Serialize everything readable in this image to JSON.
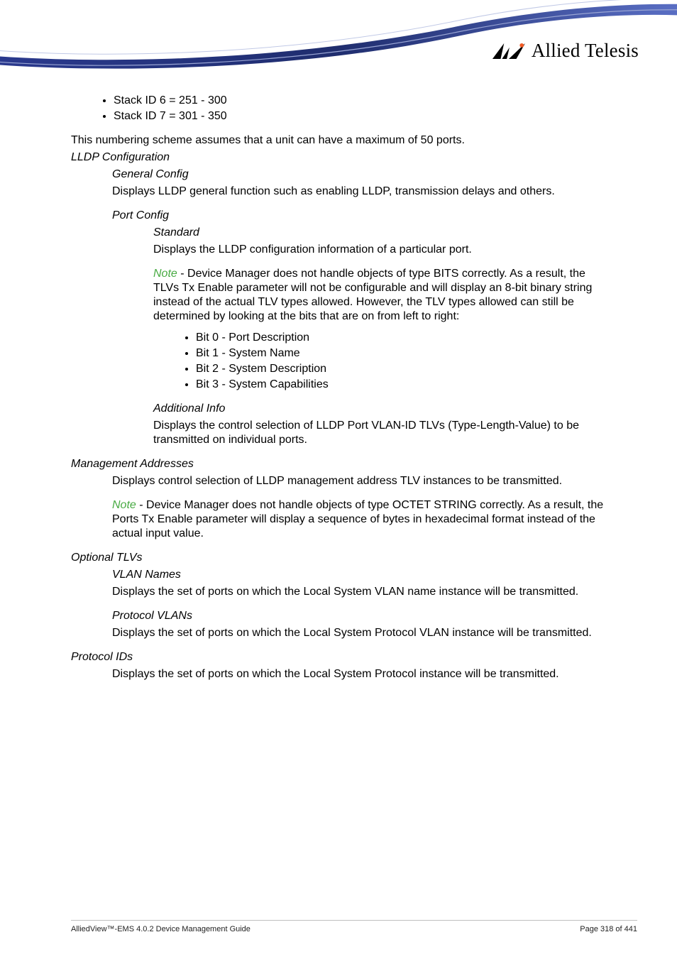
{
  "brand": {
    "text": "Allied Telesis"
  },
  "top_bullets": [
    "Stack ID 6 = 251 - 300",
    "Stack ID 7 = 301 - 350"
  ],
  "intro": "This numbering scheme assumes that a unit can have a maximum of 50 ports.",
  "lldp": {
    "heading": "LLDP Configuration",
    "general": {
      "title": "General Config",
      "body": "Displays LLDP general function such as enabling LLDP, transmission delays and others."
    },
    "port": {
      "title": "Port Config",
      "standard": {
        "title": "Standard",
        "body": "Displays the LLDP configuration information of a particular port.",
        "note_label": "Note",
        "note_body": " - Device Manager does not handle objects of type BITS correctly. As a result, the TLVs Tx Enable parameter will not be configurable and will display an 8-bit binary string instead of the actual TLV types allowed. However, the TLV types allowed can still be determined by looking at the bits that are on from left to right:",
        "bits": [
          "Bit 0 - Port Description",
          "Bit 1 - System Name",
          "Bit 2 - System Description",
          "Bit 3 - System Capabilities"
        ]
      },
      "additional": {
        "title": "Additional Info",
        "body": "Displays the control selection of LLDP Port VLAN-ID TLVs (Type-Length-Value) to be transmitted on individual ports."
      }
    }
  },
  "mgmt": {
    "heading": "Management Addresses",
    "body": "Displays control selection of LLDP management address TLV instances to be transmitted.",
    "note_label": "Note",
    "note_body": " - Device Manager does not handle objects of type OCTET STRING correctly. As a result, the Ports Tx Enable parameter will display a sequence of bytes in hexadecimal format instead of the actual input value."
  },
  "optional": {
    "heading": "Optional TLVs",
    "vlan_names": {
      "title": "VLAN Names",
      "body": "Displays the set of ports on which the Local System VLAN name instance will be transmitted."
    },
    "protocol_vlans": {
      "title": "Protocol VLANs",
      "body": "Displays the set of ports on which the Local System Protocol VLAN instance will be transmitted."
    }
  },
  "protocol_ids": {
    "heading": "Protocol IDs",
    "body": "Displays the set of ports on which the Local System Protocol instance will be transmitted."
  },
  "footer": {
    "left": "AlliedView™-EMS 4.0.2 Device Management Guide",
    "right": "Page 318 of 441"
  }
}
